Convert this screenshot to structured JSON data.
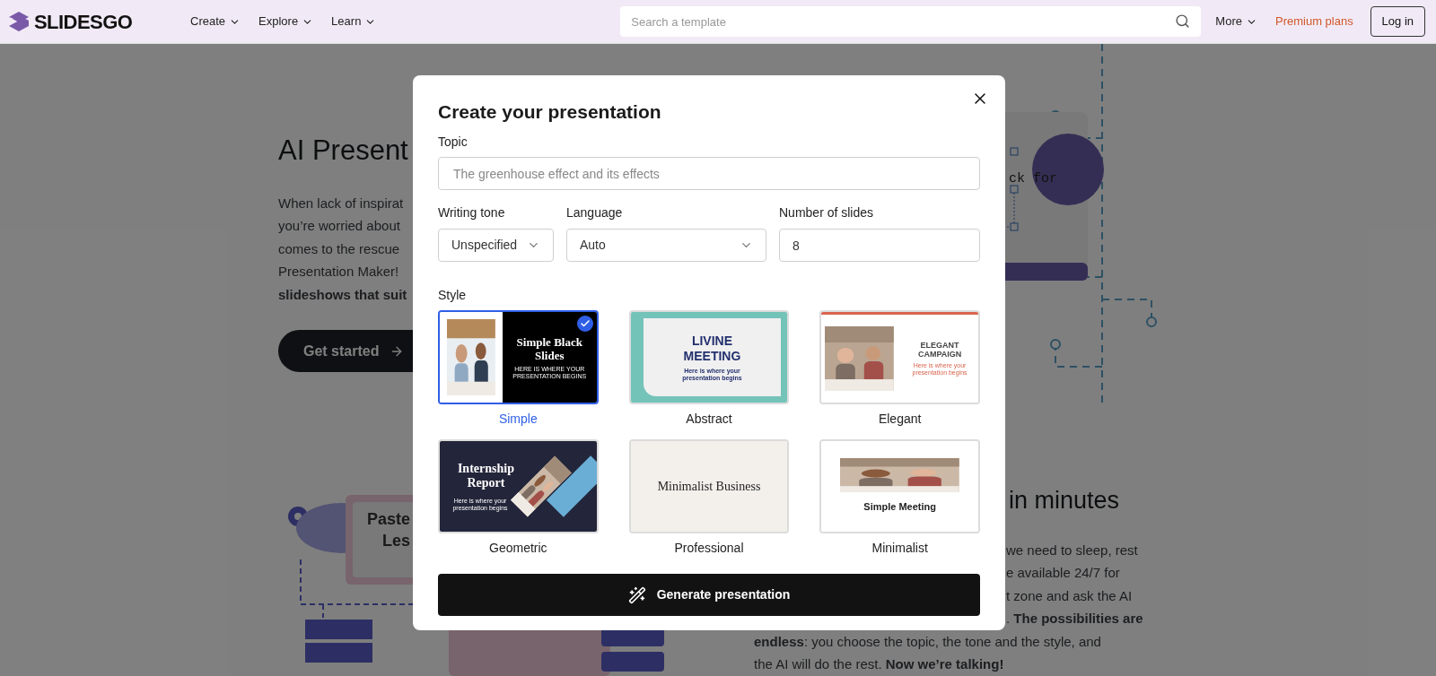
{
  "header": {
    "logo": "SLIDESGO",
    "nav": [
      {
        "label": "Create"
      },
      {
        "label": "Explore"
      },
      {
        "label": "Learn"
      }
    ],
    "search": {
      "placeholder": "Search a template"
    },
    "more": "More",
    "premium": "Premium plans",
    "login": "Log in"
  },
  "hero": {
    "title": "AI Present",
    "lines": [
      {
        "text": "When lack of inspirat",
        "bold": false
      },
      {
        "text": "you’re worried about",
        "bold": false
      },
      {
        "text": "comes to the rescue",
        "bold": false
      },
      {
        "text": "Presentation Maker!",
        "bold": false
      },
      {
        "text": "slideshows that suit",
        "bold": true
      }
    ],
    "button": "Get started"
  },
  "illustration_top": {
    "code_text": "ck for"
  },
  "illustration_bottom": {
    "card_lines": [
      "Paste",
      "Les"
    ]
  },
  "section2": {
    "title": "in minutes",
    "partial_lines": [
      "we need to sleep, rest",
      "e available 24/7 for",
      "t zone and ask the AI",
      ". **The possibilities are**"
    ],
    "lines": [
      "**endless**: you choose the topic, the tone and the style, and",
      "the AI will do the rest. **Now we’re talking!**"
    ]
  },
  "modal": {
    "title": "Create your presentation",
    "topic": {
      "label": "Topic",
      "placeholder": "The greenhouse effect and its effects"
    },
    "tone": {
      "label": "Writing tone",
      "value": "Unspecified"
    },
    "language": {
      "label": "Language",
      "value": "Auto"
    },
    "slides": {
      "label": "Number of slides",
      "value": "8"
    },
    "style_label": "Style",
    "styles": [
      {
        "label": "Simple",
        "selected": true,
        "kind": "simple",
        "title": "Simple Black Slides",
        "subtitle": "HERE IS WHERE YOUR PRESENTATION BEGINS"
      },
      {
        "label": "Abstract",
        "selected": false,
        "kind": "abstract",
        "title": "LIVINE MEETING",
        "subtitle": "Here is where your presentation begins"
      },
      {
        "label": "Elegant",
        "selected": false,
        "kind": "elegant",
        "title": "ELEGANT CAMPAIGN",
        "subtitle": "Here is where your presentation begins"
      },
      {
        "label": "Geometric",
        "selected": false,
        "kind": "geometric",
        "title": "Internship Report",
        "subtitle": "Here is where your presentation begins"
      },
      {
        "label": "Professional",
        "selected": false,
        "kind": "professional",
        "title": "Minimalist Business"
      },
      {
        "label": "Minimalist",
        "selected": false,
        "kind": "minimalist",
        "title": "Simple Meeting"
      }
    ],
    "generate": "Generate presentation"
  }
}
